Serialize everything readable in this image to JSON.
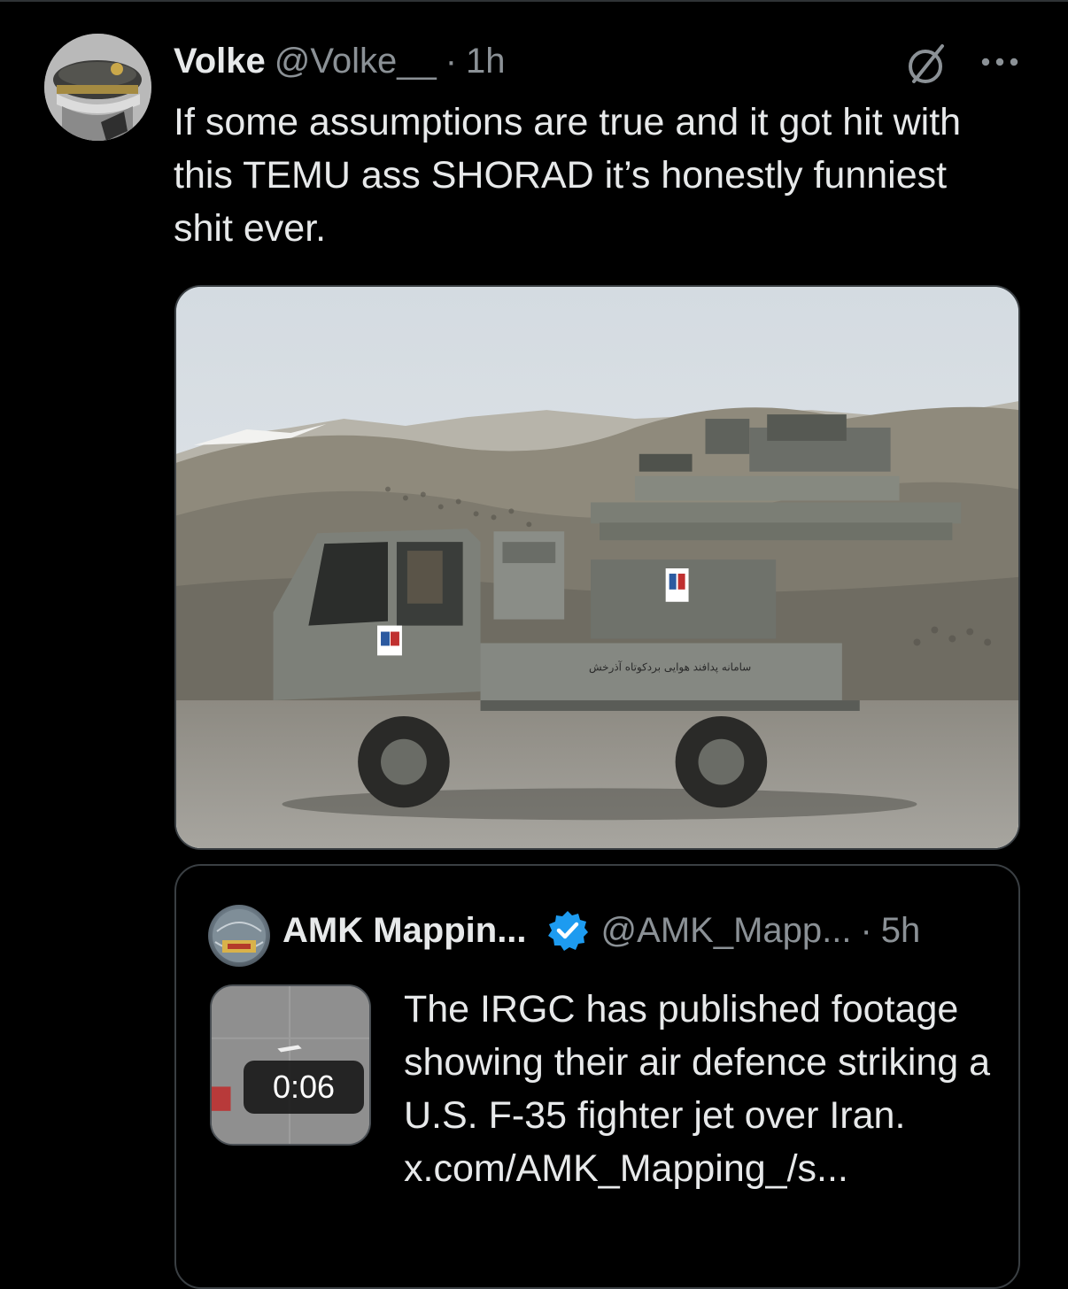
{
  "post": {
    "author_name": "Volke",
    "author_handle": "@Volke__",
    "separator": "·",
    "time": "1h",
    "text": "If some assumptions are true and it got hit with this TEMU ass SHORAD it’s honestly funniest shit ever.",
    "grok_icon": "grok-slash-circle-icon",
    "more_icon": "more-dots-icon",
    "media": {
      "type": "photo",
      "truck_inscription": "سامانه پدافند هوایی بردکوتاه آذرخش"
    }
  },
  "quote": {
    "author_name": "AMK Mappin...",
    "verified_icon": "verified-badge-icon",
    "verified_color": "#1d9bf0",
    "author_handle": "@AMK_Mapp...",
    "separator": "·",
    "time": "5h",
    "video_duration": "0:06",
    "text": "The IRGC has published footage showing their air defence striking a U.S. F-35 fighter jet over Iran.",
    "link": "x.com/AMK_Mapping_/s..."
  },
  "colors": {
    "background": "#000000",
    "primary_text": "#e7e9ea",
    "secondary_text": "#8b9196",
    "border": "#3a3f43"
  }
}
